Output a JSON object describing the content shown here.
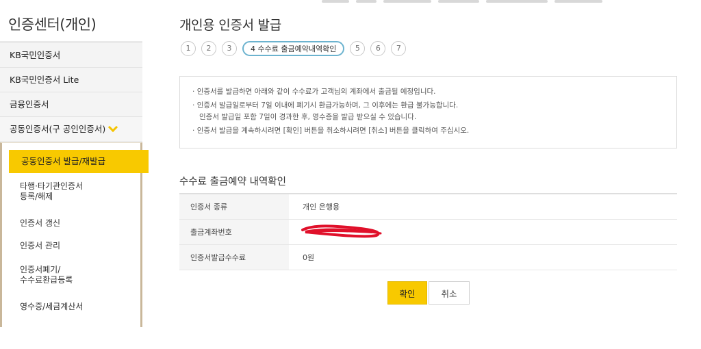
{
  "sidebar": {
    "title": "인증센터(개인)",
    "items": [
      {
        "label": "KB국민인증서"
      },
      {
        "label": "KB국민인증서 Lite"
      },
      {
        "label": "금융인증서"
      },
      {
        "label": "공동인증서(구 공인인증서)"
      }
    ],
    "submenu": [
      {
        "label": "공동인증서 발급/재발급",
        "active": true
      },
      {
        "label_line1": "타행·타기관인증서",
        "label_line2": "등록/해제"
      },
      {
        "label": "인증서 갱신"
      },
      {
        "label": "인증서 관리"
      },
      {
        "label_line1": "인증서폐기/",
        "label_line2": "수수료환급등록"
      },
      {
        "label": "영수증/세금계산서"
      }
    ]
  },
  "main": {
    "title": "개인용 인증서 발급",
    "steps": [
      "1",
      "2",
      "3",
      "4 수수료 출금예약내역확인",
      "5",
      "6",
      "7"
    ],
    "notice": [
      "인증서를 발급하면 아래와 같이 수수료가 고객님의 계좌에서 출금될 예정입니다.",
      "인증서 발급일로부터 7일 이내에 폐기시 환급가능하며, 그 이후에는 환급 불가능합니다.",
      "인증서 발급일 포함 7일이 경과한 후, 영수증을 발급 받으실 수 있습니다.",
      "인증서 발급을 계속하시려면 [확인] 버튼을 취소하시려면 [취소] 버튼을 클릭하여 주십시오."
    ],
    "section_title": "수수료 출금예약 내역확인",
    "table": [
      {
        "label": "인증서 종류",
        "value": "개인 은행용"
      },
      {
        "label": "출금계좌번호",
        "value": ""
      },
      {
        "label": "인증서발급수수료",
        "value": "0원"
      }
    ],
    "buttons": {
      "confirm": "확인",
      "cancel": "취소"
    }
  },
  "colors": {
    "accent": "#f8c900",
    "step_border": "#6cb3cf",
    "scribble": "#e0102a"
  }
}
